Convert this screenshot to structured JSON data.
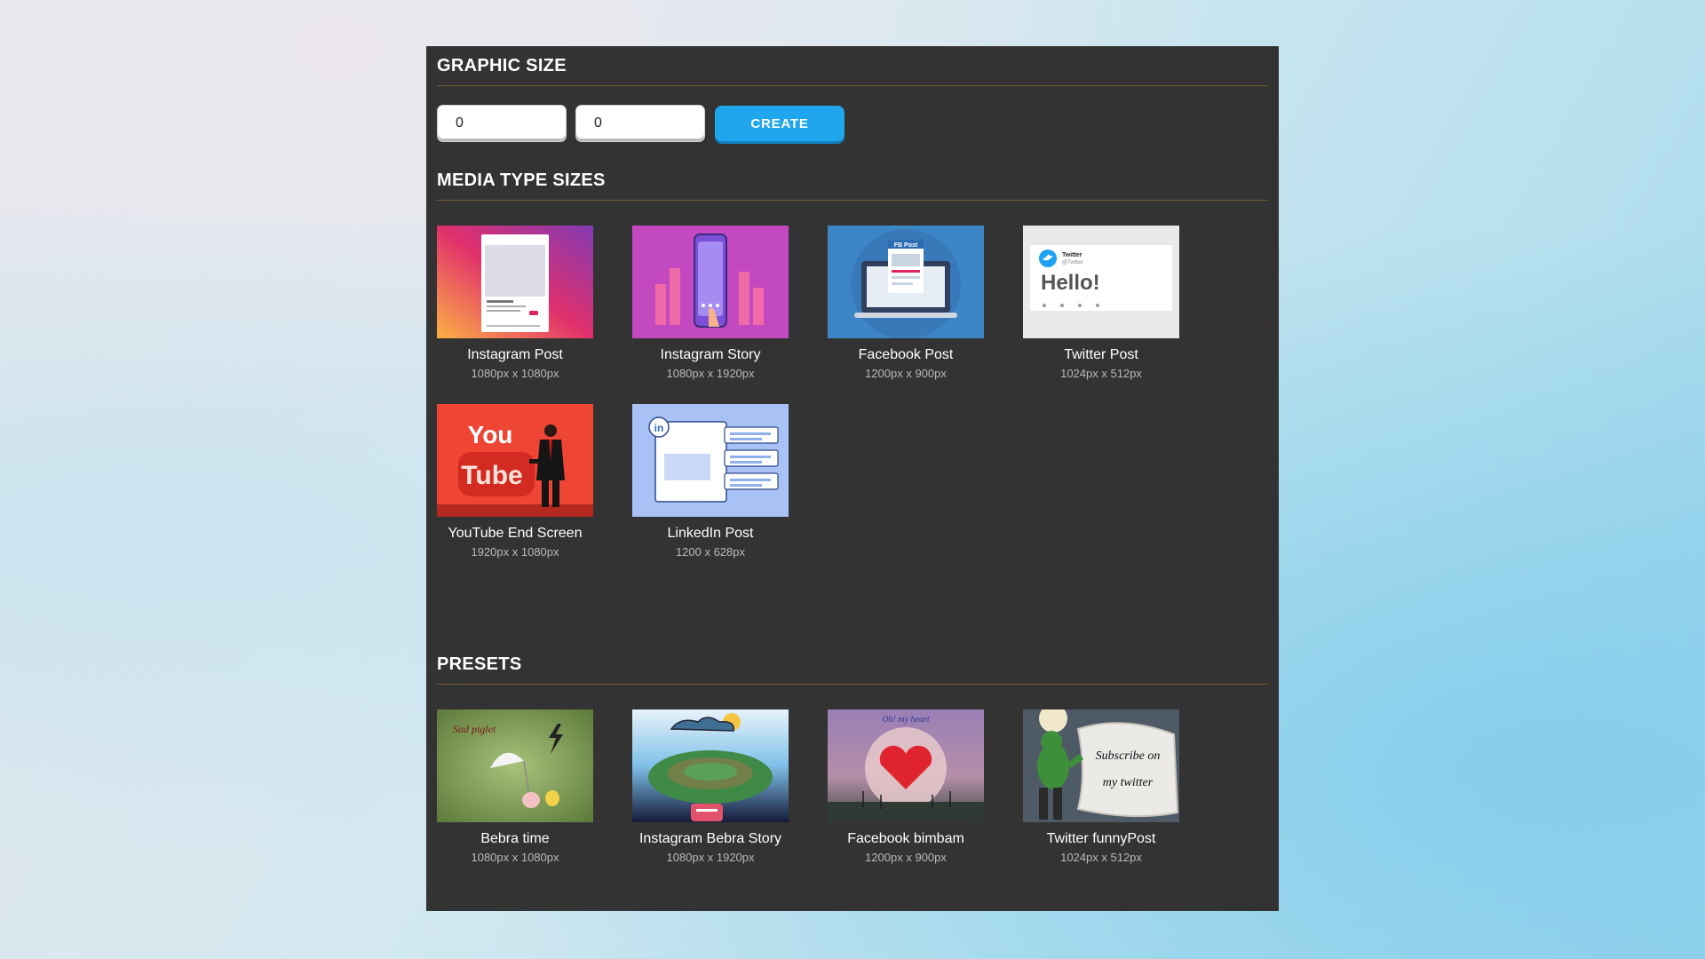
{
  "graphic_size": {
    "title": "GRAPHIC SIZE",
    "width_value": "0",
    "height_value": "0",
    "create_label": "CREATE"
  },
  "media": {
    "title": "MEDIA TYPE SIZES",
    "items": [
      {
        "name": "Instagram Post",
        "size": "1080px x 1080px",
        "icon": "instagram-post-thumbnail"
      },
      {
        "name": "Instagram Story",
        "size": "1080px x 1920px",
        "icon": "instagram-story-thumbnail"
      },
      {
        "name": "Facebook Post",
        "size": "1200px x 900px",
        "icon": "facebook-post-thumbnail",
        "thumb_label": "FB Post"
      },
      {
        "name": "Twitter Post",
        "size": "1024px x 512px",
        "icon": "twitter-post-thumbnail",
        "thumb_brand": "Twitter",
        "thumb_handle": "@Twitter",
        "thumb_text": "Hello!"
      },
      {
        "name": "YouTube End Screen",
        "size": "1920px x 1080px",
        "icon": "youtube-end-screen-thumbnail",
        "thumb_you": "You",
        "thumb_tube": "Tube"
      },
      {
        "name": "LinkedIn Post",
        "size": "1200 x 628px",
        "icon": "linkedin-post-thumbnail",
        "thumb_logo": "in"
      }
    ]
  },
  "presets": {
    "title": "PRESETS",
    "items": [
      {
        "name": "Bebra time",
        "size": "1080px x 1080px",
        "icon": "bebra-time-thumbnail",
        "thumb_text": "Sad piglet"
      },
      {
        "name": "Instagram Bebra Story",
        "size": "1080px x 1920px",
        "icon": "instagram-bebra-story-thumbnail"
      },
      {
        "name": "Facebook bimbam",
        "size": "1200px x 900px",
        "icon": "facebook-bimbam-thumbnail",
        "thumb_text": "Oh! my heart"
      },
      {
        "name": "Twitter funnyPost",
        "size": "1024px x 512px",
        "icon": "twitter-funnypost-thumbnail",
        "thumb_line1": "Subscribe on",
        "thumb_line2": "my twitter"
      }
    ]
  },
  "colors": {
    "panel": "#333333",
    "accent": "#1fa6ec",
    "divider": "#6f5a2c"
  }
}
